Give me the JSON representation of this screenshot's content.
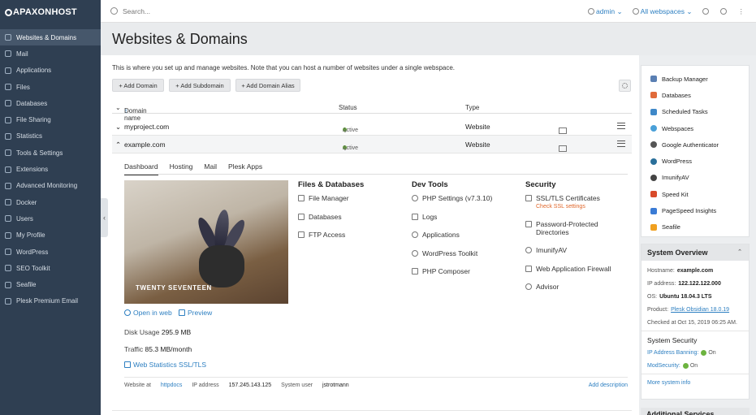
{
  "brand": {
    "name": "APAXONHOST"
  },
  "sidebar": {
    "items": [
      {
        "label": "Websites & Domains",
        "icon": "monitor-icon"
      },
      {
        "label": "Mail",
        "icon": "envelope-icon"
      },
      {
        "label": "Applications",
        "icon": "apps-icon"
      },
      {
        "label": "Files",
        "icon": "file-icon"
      },
      {
        "label": "Databases",
        "icon": "database-icon"
      },
      {
        "label": "File Sharing",
        "icon": "share-icon"
      },
      {
        "label": "Statistics",
        "icon": "chart-icon"
      },
      {
        "label": "Tools & Settings",
        "icon": "wrench-icon"
      },
      {
        "label": "Extensions",
        "icon": "puzzle-icon"
      },
      {
        "label": "Advanced Monitoring",
        "icon": "monitoring-icon"
      },
      {
        "label": "Docker",
        "icon": "docker-icon"
      },
      {
        "label": "Users",
        "icon": "user-icon"
      },
      {
        "label": "My Profile",
        "icon": "profile-icon"
      },
      {
        "label": "WordPress",
        "icon": "wordpress-icon"
      },
      {
        "label": "SEO Toolkit",
        "icon": "seo-icon"
      },
      {
        "label": "Seafile",
        "icon": "seafile-icon"
      },
      {
        "label": "Plesk Premium Email",
        "icon": "premium-email-icon"
      }
    ],
    "collapse_glyph": "‹"
  },
  "topbar": {
    "search_placeholder": "Search...",
    "user": "admin",
    "webspaces": "All webspaces",
    "caret": "⌄"
  },
  "page": {
    "title": "Websites & Domains",
    "intro": "This is where you set up and manage websites. Note that you can host a number of websites under a single webspace."
  },
  "toolbar": {
    "add_domain": "+ Add Domain",
    "add_subdomain": "+ Add Subdomain",
    "add_alias": "+ Add Domain Alias"
  },
  "table": {
    "headers": {
      "name": "Domain name",
      "sort": "↑",
      "status": "Status",
      "type": "Type"
    },
    "rows": [
      {
        "name": "myproject.com",
        "status": "Active",
        "type": "Website"
      },
      {
        "name": "example.com",
        "status": "Active",
        "type": "Website"
      }
    ]
  },
  "panel": {
    "tabs": [
      "Dashboard",
      "Hosting",
      "Mail",
      "Plesk Apps"
    ],
    "theme_name": "TWENTY SEVENTEEN",
    "open_in_web": "Open in web",
    "preview": "Preview",
    "disk_usage_label": "Disk Usage",
    "disk_usage_value": "295.9 MB",
    "traffic_label": "Traffic",
    "traffic_value": "85.3 MB/month",
    "web_stats": "Web Statistics SSL/TLS",
    "files_db": {
      "title": "Files & Databases",
      "items": [
        "File Manager",
        "Databases",
        "FTP Access"
      ]
    },
    "dev_tools": {
      "title": "Dev Tools",
      "items": [
        "PHP Settings (v7.3.10)",
        "Logs",
        "Applications",
        "WordPress Toolkit",
        "PHP Composer"
      ]
    },
    "security": {
      "title": "Security",
      "items": [
        "SSL/TLS Certificates",
        "Password-Protected Directories",
        "ImunifyAV",
        "Web Application Firewall",
        "Advisor"
      ],
      "ssl_sub": "Check SSL settings"
    },
    "footer": {
      "website_at_label": "Website at",
      "website_at_value": "httpdocs",
      "ip_label": "IP address",
      "ip_value": "157.245.143.125",
      "sysuser_label": "System user",
      "sysuser_value": "jstrotmann",
      "add_description": "Add description"
    }
  },
  "right": {
    "tools": [
      {
        "label": "Backup Manager",
        "color": "#5a7fb3"
      },
      {
        "label": "Databases",
        "color": "#e06a3a"
      },
      {
        "label": "Scheduled Tasks",
        "color": "#3e88c8"
      },
      {
        "label": "Webspaces",
        "color": "#4aa0d8"
      },
      {
        "label": "Google Authenticator",
        "color": "#555555"
      },
      {
        "label": "WordPress",
        "color": "#2a6f9a"
      },
      {
        "label": "ImunifyAV",
        "color": "#444444"
      },
      {
        "label": "Speed Kit",
        "color": "#d84a2a"
      },
      {
        "label": "PageSpeed Insights",
        "color": "#3a7bd5"
      },
      {
        "label": "Seafile",
        "color": "#f0a020"
      }
    ],
    "system_overview": {
      "title": "System Overview",
      "hostname_label": "Hostname:",
      "hostname_value": "example.com",
      "ip_label": "IP address:",
      "ip_value": "122.122.122.000",
      "os_label": "OS:",
      "os_value": "Ubuntu 18.04.3 LTS",
      "product_label": "Product:",
      "product_value": "Plesk Obsidian 18.0.19",
      "checked": "Checked at Oct 15, 2019 06:25 AM.",
      "security_title": "System Security",
      "ip_banning_label": "IP Address Banning:",
      "ip_banning_value": "On",
      "modsec_label": "ModSecurity:",
      "modsec_value": "On",
      "more_info": "More system info"
    },
    "additional_services": "Additional Services"
  },
  "colors": {
    "sidebar_bg": "#2f3f52",
    "accent": "#2d7fc1",
    "active": "#6cb33f",
    "warning": "#e0672b"
  }
}
